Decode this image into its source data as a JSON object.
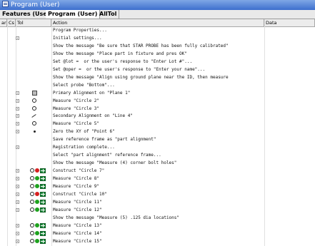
{
  "window": {
    "title": "Program (User)"
  },
  "tabs": [
    "Features (User)",
    "Program (User)",
    "AllTol"
  ],
  "columns": [
    "ar",
    "Cs",
    "Tol",
    "Action",
    "Data"
  ],
  "rows": [
    {
      "text": "Program Properties...",
      "expand": false,
      "icon": ""
    },
    {
      "text": "Initial settings...",
      "expand": true,
      "icon": ""
    },
    {
      "text": "Show the message \"Be sure that STAR PROBE has been fully calibrated\"",
      "expand": false,
      "icon": ""
    },
    {
      "text": "Show the message \"Place part in fixture and pres OK\"",
      "expand": false,
      "icon": ""
    },
    {
      "text": "Set @lot =  or the user's response to \"Enter Lot #\"...",
      "expand": false,
      "icon": ""
    },
    {
      "text": "Set @oper =  or the user's response to \"Enter your name\"...",
      "expand": false,
      "icon": ""
    },
    {
      "text": "Show the message \"Align using ground plane near the ID, then measure",
      "expand": false,
      "icon": ""
    },
    {
      "text": "Select probe \"Bottom\"...",
      "expand": false,
      "icon": ""
    },
    {
      "text": "Primary Alignment on \"Plane 1\"",
      "expand": true,
      "icon": "plane"
    },
    {
      "text": "Measure \"Circle 2\"",
      "expand": true,
      "icon": "circle"
    },
    {
      "text": "Measure \"Circle 3\"",
      "expand": true,
      "icon": "circle"
    },
    {
      "text": "Secondary Alignment on \"Line 4\"",
      "expand": true,
      "icon": "line"
    },
    {
      "text": "Measure \"Circle 5\"",
      "expand": true,
      "icon": "circle"
    },
    {
      "text": "Zero the XY of \"Point 6\"",
      "expand": true,
      "icon": "dot"
    },
    {
      "text": "Save reference frame as \"part alignment\"",
      "expand": false,
      "icon": ""
    },
    {
      "text": "Registration complete...",
      "expand": true,
      "icon": ""
    },
    {
      "text": "Select \"part alignment\" reference frame...",
      "expand": false,
      "icon": ""
    },
    {
      "text": "Show the message \"Measure (4) corner bolt holes\"",
      "expand": false,
      "icon": ""
    },
    {
      "text": "Construct \"Circle 7\"",
      "expand": true,
      "icon": "cons-red"
    },
    {
      "text": "Measure \"Circle 8\"",
      "expand": true,
      "icon": "meas-green"
    },
    {
      "text": "Measure \"Circle 9\"",
      "expand": true,
      "icon": "meas-green"
    },
    {
      "text": "Construct \"Circle 10\"",
      "expand": true,
      "icon": "cons-red"
    },
    {
      "text": "Measure \"Circle 11\"",
      "expand": true,
      "icon": "meas-green"
    },
    {
      "text": "Measure \"Circle 12\"",
      "expand": true,
      "icon": "meas-green"
    },
    {
      "text": "Show the message \"Measure (5) .125 dia locations\"",
      "expand": false,
      "icon": ""
    },
    {
      "text": "Measure \"Circle 13\"",
      "expand": true,
      "icon": "meas-green"
    },
    {
      "text": "Measure \"Circle 14\"",
      "expand": true,
      "icon": "meas-green"
    },
    {
      "text": "Measure \"Circle 15\"",
      "expand": true,
      "icon": "meas-green"
    }
  ]
}
